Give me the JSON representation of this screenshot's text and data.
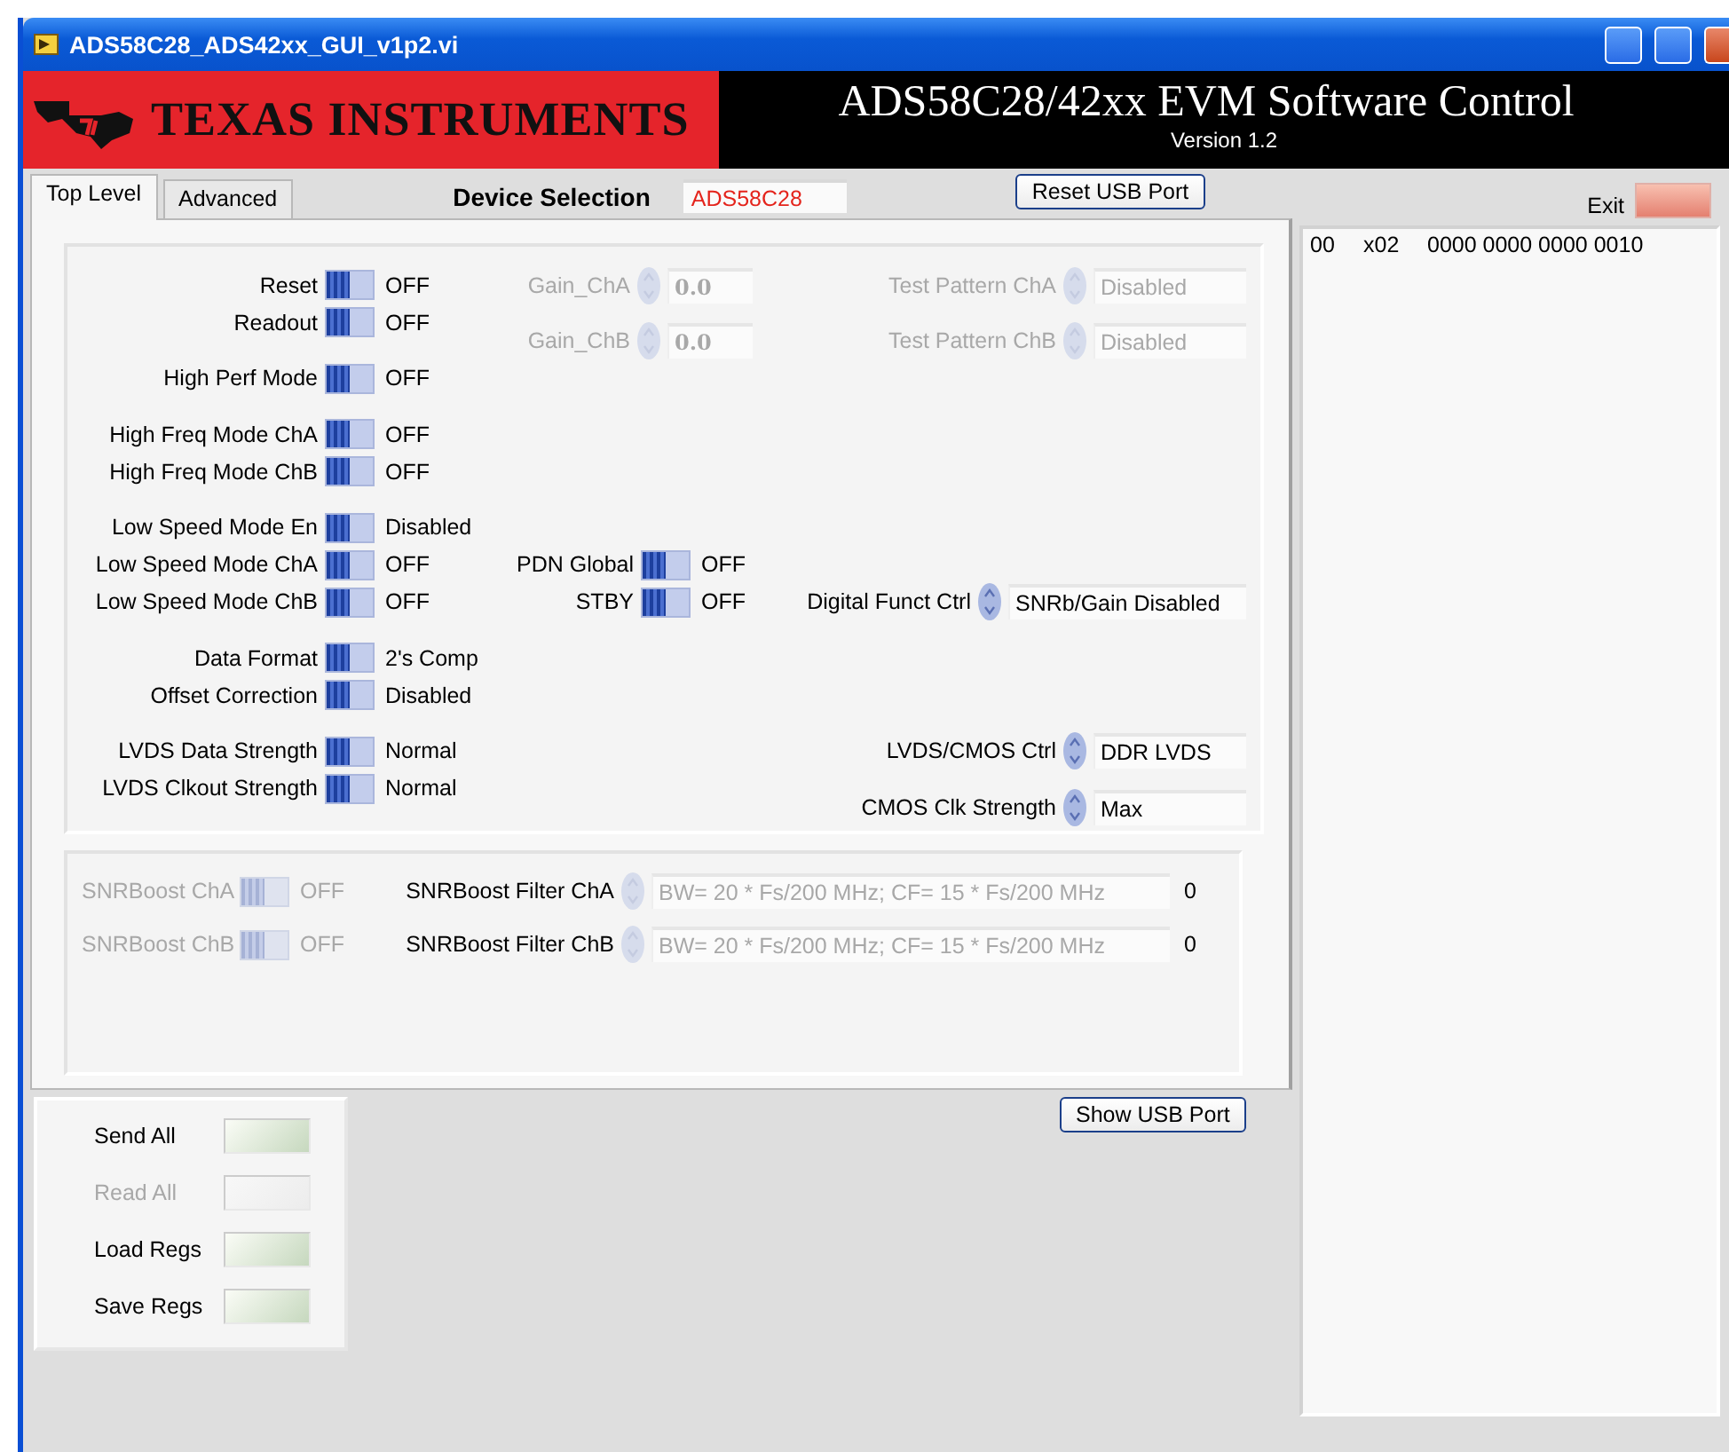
{
  "window": {
    "title": "ADS58C28_ADS42xx_GUI_v1p2.vi"
  },
  "banner": {
    "company": "TEXAS INSTRUMENTS",
    "title": "ADS58C28/42xx EVM Software Control",
    "version": "Version 1.2"
  },
  "tabs": [
    {
      "label": "Top Level",
      "selected": true
    },
    {
      "label": "Advanced",
      "selected": false
    }
  ],
  "device_selection": {
    "label": "Device Selection",
    "value": "ADS58C28"
  },
  "reset_usb_button": {
    "label": "Reset USB Port"
  },
  "exit": {
    "label": "Exit"
  },
  "log": [
    {
      "address": "00",
      "register": "x02",
      "bits": "0000 0000 0000 0010"
    }
  ],
  "toggles": [
    {
      "label": "Reset",
      "value": "OFF",
      "on": false
    },
    {
      "label": "Readout",
      "value": "OFF",
      "on": false
    },
    {
      "label": "High Perf Mode",
      "value": "OFF",
      "on": false
    },
    {
      "label": "High Freq Mode ChA",
      "value": "OFF",
      "on": false
    },
    {
      "label": "High Freq Mode ChB",
      "value": "OFF",
      "on": false
    },
    {
      "label": "Low Speed Mode En",
      "value": "Disabled",
      "on": false
    },
    {
      "label": "Low Speed Mode ChA",
      "value": "OFF",
      "on": false
    },
    {
      "label": "Low Speed Mode ChB",
      "value": "OFF",
      "on": false
    },
    {
      "label": "Data Format",
      "value": "2's Comp",
      "on": false
    },
    {
      "label": "Offset Correction",
      "value": "Disabled",
      "on": false
    },
    {
      "label": "LVDS Data Strength",
      "value": "Normal",
      "on": false
    },
    {
      "label": "LVDS Clkout Strength",
      "value": "Normal",
      "on": false
    }
  ],
  "gains": [
    {
      "label": "Gain_ChA",
      "value": "0.0",
      "disabled": true
    },
    {
      "label": "Gain_ChB",
      "value": "0.0",
      "disabled": true
    }
  ],
  "power_toggles": [
    {
      "label": "PDN Global",
      "value": "OFF",
      "on": false
    },
    {
      "label": "STBY",
      "value": "OFF",
      "on": false
    }
  ],
  "rings": [
    {
      "label": "Test Pattern ChA",
      "value": "Disabled",
      "disabled": true
    },
    {
      "label": "Test Pattern ChB",
      "value": "Disabled",
      "disabled": true
    },
    {
      "label": "Digital Funct Ctrl",
      "value": "SNRb/Gain Disabled",
      "disabled": false
    },
    {
      "label": "LVDS/CMOS Ctrl",
      "value": "DDR LVDS",
      "disabled": false
    },
    {
      "label": "CMOS Clk Strength",
      "value": "Max",
      "disabled": false
    }
  ],
  "snrboost": [
    {
      "toggle": {
        "label": "SNRBoost ChA",
        "value": "OFF",
        "on": false,
        "disabled": true
      },
      "filter": {
        "label": "SNRBoost Filter ChA",
        "value": "BW= 20 * Fs/200 MHz; CF= 15 * Fs/200 MHz",
        "disabled": true
      },
      "reading": "0"
    },
    {
      "toggle": {
        "label": "SNRBoost ChB",
        "value": "OFF",
        "on": false,
        "disabled": true
      },
      "filter": {
        "label": "SNRBoost Filter ChB",
        "value": "BW= 20 * Fs/200 MHz; CF= 15 * Fs/200 MHz",
        "disabled": true
      },
      "reading": "0"
    }
  ],
  "actions": [
    {
      "label": "Send All",
      "disabled": false
    },
    {
      "label": "Read All",
      "disabled": true
    },
    {
      "label": "Load Regs",
      "disabled": false
    },
    {
      "label": "Save Regs",
      "disabled": false
    }
  ],
  "show_usb_button": {
    "label": "Show USB Port"
  }
}
